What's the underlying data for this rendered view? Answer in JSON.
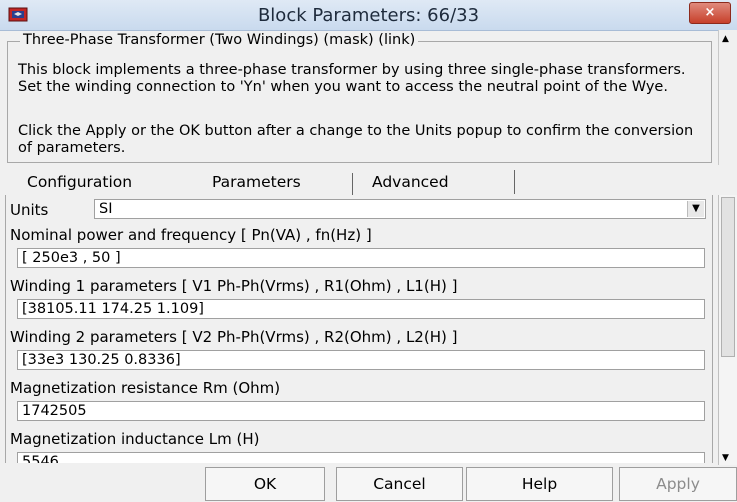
{
  "window": {
    "title": "Block Parameters: 66/33",
    "close_label": "×",
    "icon": "simulink-block-icon"
  },
  "mask": {
    "group_title": "Three-Phase Transformer (Two Windings) (mask) (link)",
    "description_1": "This block implements a three-phase transformer by using three single-phase transformers. Set the winding connection to 'Yn' when you want to access the neutral point of the Wye.",
    "description_2": "Click the Apply or the OK button after a change to the Units popup to confirm the conversion of parameters."
  },
  "tabs": [
    {
      "label": "Configuration"
    },
    {
      "label": "Parameters"
    },
    {
      "label": "Advanced"
    }
  ],
  "params": {
    "units_label": "Units",
    "units_value": "SI",
    "nominal_label": "Nominal power and frequency  [ Pn(VA) , fn(Hz) ]",
    "nominal_value": "[ 250e3 , 50 ]",
    "w1_label": "Winding 1 parameters [ V1 Ph-Ph(Vrms) , R1(Ohm) , L1(H) ]",
    "w1_value": "[38105.11 174.25 1.109]",
    "w2_label": "Winding 2 parameters [ V2 Ph-Ph(Vrms) , R2(Ohm) , L2(H) ]",
    "w2_value": "[33e3 130.25 0.8336]",
    "rm_label": "Magnetization resistance  Rm (Ohm)",
    "rm_value": "1742505",
    "lm_label": "Magnetization inductance  Lm (H)",
    "lm_value": "5546"
  },
  "buttons": {
    "ok": "OK",
    "cancel": "Cancel",
    "help": "Help",
    "apply": "Apply"
  }
}
